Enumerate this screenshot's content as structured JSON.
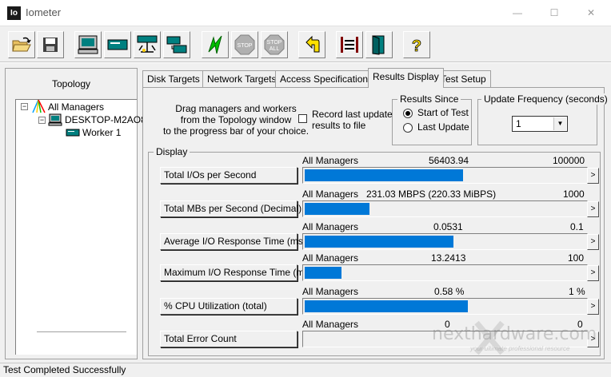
{
  "window": {
    "app_icon_text": "Io",
    "title": "Iometer",
    "minimize": "—",
    "maximize": "☐",
    "close": "✕"
  },
  "toolbar": {
    "icons": [
      "open-icon",
      "save-icon",
      "show-results-icon",
      "new-disk-worker-icon",
      "new-network-worker-icon",
      "copy-worker-icon",
      "start-tests-icon",
      "stop-icon",
      "stop-all-icon",
      "reset-workers-icon",
      "exit-icon",
      "quit-icon",
      "help-icon"
    ],
    "stop_label": "STOP",
    "stop_all_label": "STOP\nALL",
    "help_label": "?"
  },
  "topology": {
    "title": "Topology",
    "items": [
      {
        "label": "All Managers",
        "expander": "−"
      },
      {
        "label": "DESKTOP-M2AO8",
        "expander": "−"
      },
      {
        "label": "Worker 1"
      }
    ]
  },
  "tabs": [
    "Disk Targets",
    "Network Targets",
    "Access Specifications",
    "Results Display",
    "Test Setup"
  ],
  "active_tab": "Results Display",
  "results": {
    "drag_text_1": "Drag managers and workers",
    "drag_text_2": "from the Topology window",
    "drag_text_3": "to the progress bar of your choice.",
    "record_label_1": "Record last update",
    "record_label_2": "results to file",
    "results_since_title": "Results Since",
    "start_of_test": "Start of Test",
    "last_update": "Last Update",
    "update_freq_title": "Update Frequency (seconds)",
    "update_freq_value": "1",
    "display_title": "Display",
    "arrow": ">",
    "metrics": [
      {
        "name": "Total I/Os per Second",
        "source": "All Managers",
        "value": "56403.94",
        "max": "100000",
        "fraction": 0.564
      },
      {
        "name": "Total MBs per Second (Decimal)",
        "source": "All Managers",
        "value": "231.03 MBPS (220.33 MiBPS)",
        "max": "1000",
        "fraction": 0.231
      },
      {
        "name": "Average I/O Response Time (ms)",
        "source": "All Managers",
        "value": "0.0531",
        "max": "0.1",
        "fraction": 0.531
      },
      {
        "name": "Maximum I/O Response Time (ms)",
        "source": "All Managers",
        "value": "13.2413",
        "max": "100",
        "fraction": 0.132
      },
      {
        "name": "% CPU Utilization (total)",
        "source": "All Managers",
        "value": "0.58 %",
        "max": "1 %",
        "fraction": 0.58
      },
      {
        "name": "Total Error Count",
        "source": "All Managers",
        "value": "0",
        "max": "0",
        "fraction": 0
      }
    ]
  },
  "status": "Test Completed Successfully",
  "watermark": {
    "text": "nexthardware.com",
    "sub": "your ultimate professional resource"
  },
  "colors": {
    "bar_fill": "#0078d7",
    "chrome": "#f0f0f0"
  }
}
